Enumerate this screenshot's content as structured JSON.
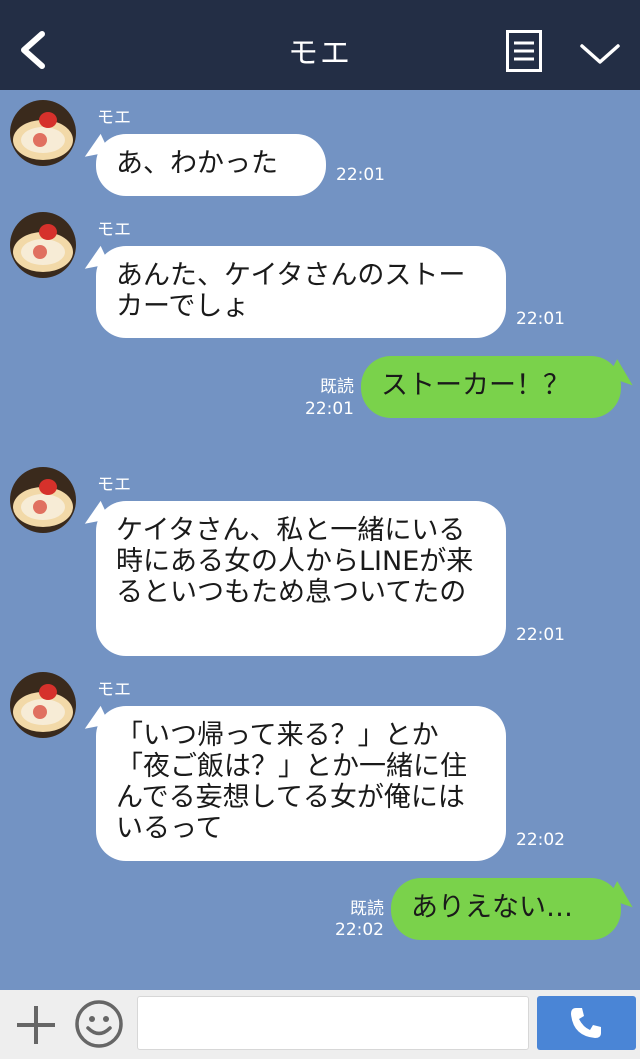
{
  "header": {
    "title": "モエ"
  },
  "messages": [
    {
      "sender": "モエ",
      "text": "あ、わかった",
      "time": "22:01"
    },
    {
      "sender": "モエ",
      "text": "あんた、ケイタさんのストーカーでしょ",
      "time": "22:01"
    },
    {
      "text": "ストーカー！？",
      "read": "既読",
      "time": "22:01"
    },
    {
      "sender": "モエ",
      "text": "ケイタさん、私と一緒にいる時にある女の人からLINEが来るといつもため息ついてたの",
      "time": "22:01"
    },
    {
      "sender": "モエ",
      "text": "「いつ帰って来る？」とか「夜ご飯は？」とか一緒に住んでる妄想してる女が俺にはいるって",
      "time": "22:02"
    },
    {
      "text": "ありえない…",
      "read": "既読",
      "time": "22:02"
    }
  ],
  "input": {
    "placeholder": ""
  },
  "colors": {
    "header": "#232e45",
    "background": "#7393c3",
    "outgoing": "#7ad24b",
    "incoming": "#ffffff",
    "call": "#4a85d6"
  },
  "icons": [
    "back-icon",
    "menu-icon",
    "chevron-down-icon",
    "plus-icon",
    "emoji-icon",
    "phone-icon"
  ]
}
